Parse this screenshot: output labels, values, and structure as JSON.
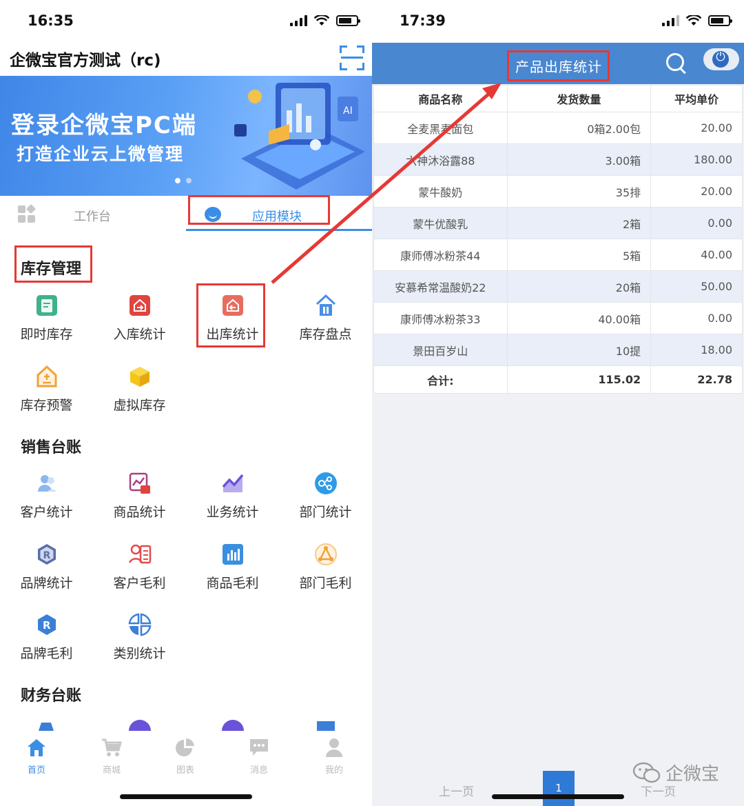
{
  "left": {
    "status": {
      "time": "16:35"
    },
    "app_title": "企微宝官方测试（rc)",
    "banner": {
      "headline": "登录企微宝PC端",
      "subline": "打造企业云上微管理"
    },
    "tabs": [
      {
        "label": "工作台"
      },
      {
        "label": "应用模块"
      }
    ],
    "sections": {
      "inventory": {
        "title": "库存管理",
        "items": [
          {
            "label": "即时库存",
            "icon": "report-icon",
            "color": "#3fb28a"
          },
          {
            "label": "入库统计",
            "icon": "warehouse-in-icon",
            "color": "#e0443e"
          },
          {
            "label": "出库统计",
            "icon": "warehouse-out-icon",
            "color": "#e86c5f"
          },
          {
            "label": "库存盘点",
            "icon": "house-inventory-icon",
            "color": "#4a8ee6"
          },
          {
            "label": "库存预警",
            "icon": "house-alert-icon",
            "color": "#f0a13a"
          },
          {
            "label": "虚拟库存",
            "icon": "cube-icon",
            "color": "#f5c518"
          }
        ]
      },
      "sales": {
        "title": "销售台账",
        "items": [
          {
            "label": "客户统计",
            "icon": "customers-icon",
            "color": "#8cb8ef"
          },
          {
            "label": "商品统计",
            "icon": "chart-bag-icon",
            "color": "#a9407f"
          },
          {
            "label": "业务统计",
            "icon": "trend-icon",
            "color": "#6a53d8"
          },
          {
            "label": "部门统计",
            "icon": "org-icon",
            "color": "#2f9be6"
          },
          {
            "label": "品牌统计",
            "icon": "brand-icon",
            "color": "#5a6fa8"
          },
          {
            "label": "客户毛利",
            "icon": "customer-card-icon",
            "color": "#e34a4a"
          },
          {
            "label": "商品毛利",
            "icon": "bar-chart-icon",
            "color": "#3b8fe0"
          },
          {
            "label": "部门毛利",
            "icon": "triangle-nodes-icon",
            "color": "#f0a13a"
          },
          {
            "label": "品牌毛利",
            "icon": "brand-r-icon",
            "color": "#3b7fd8"
          },
          {
            "label": "类别统计",
            "icon": "pie-icon",
            "color": "#3b7fd8"
          }
        ]
      },
      "finance": {
        "title": "财务台账"
      }
    },
    "bottom_nav": [
      {
        "label": "首页",
        "icon": "home-icon"
      },
      {
        "label": "商城",
        "icon": "cart-icon"
      },
      {
        "label": "图表",
        "icon": "pie-chart-icon"
      },
      {
        "label": "消息",
        "icon": "message-icon"
      },
      {
        "label": "我的",
        "icon": "user-icon"
      }
    ],
    "accent_color": "#3a8ee6",
    "highlight_color": "#e53935"
  },
  "right": {
    "status": {
      "time": "17:39"
    },
    "title": "产品出库统计",
    "header_color": "#4a87d1",
    "table": {
      "columns": [
        "商品名称",
        "发货数量",
        "平均单价"
      ],
      "rows": [
        [
          "全麦黑麦面包",
          "0箱2.00包",
          "20.00"
        ],
        [
          "六神沐浴露88",
          "3.00箱",
          "180.00"
        ],
        [
          "蒙牛酸奶",
          "35排",
          "20.00"
        ],
        [
          "蒙牛优酸乳",
          "2箱",
          "0.00"
        ],
        [
          "康师傅冰粉茶44",
          "5箱",
          "40.00"
        ],
        [
          "安慕希常温酸奶22",
          "20箱",
          "50.00"
        ],
        [
          "康师傅冰粉茶33",
          "40.00箱",
          "0.00"
        ],
        [
          "景田百岁山",
          "10提",
          "18.00"
        ]
      ],
      "total": [
        "合计:",
        "115.02",
        "22.78"
      ]
    },
    "pager": {
      "prev": "上一页",
      "current": "1",
      "next": "下一页"
    },
    "watermark": "企微宝"
  }
}
